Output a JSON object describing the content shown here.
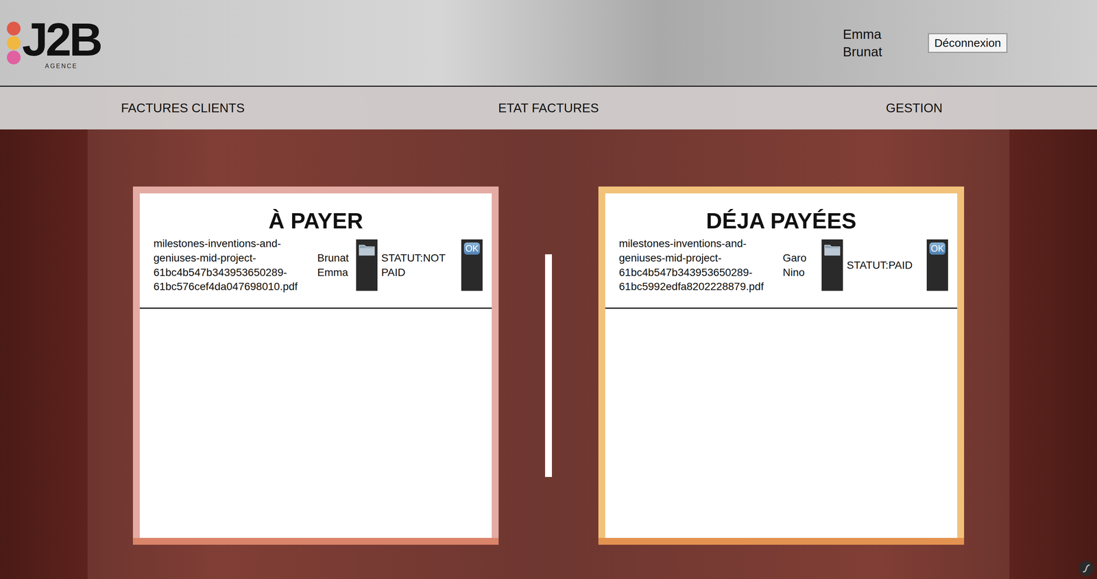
{
  "header": {
    "logo": {
      "text": "J2B",
      "subtitle": "AGENCE"
    },
    "user": {
      "first_name": "Emma",
      "last_name": "Brunat"
    },
    "logout_button": "Déconnexion"
  },
  "nav": [
    {
      "label": "FACTURES CLIENTS"
    },
    {
      "label": "ETAT FACTURES"
    },
    {
      "label": "GESTION"
    }
  ],
  "panels": [
    {
      "title": "À PAYER",
      "color": "#e3aba4",
      "invoices": [
        {
          "file": "milestones-inventions-and-geniuses-mid-project-61bc4b547b343953650289-61bc576cef4da047698010.pdf",
          "client": "Brunat Emma",
          "status": "STATUT:NOT PAID",
          "ok_button": "OK"
        }
      ]
    },
    {
      "title": "DÉJA PAYÉES",
      "color": "#f2c27a",
      "invoices": [
        {
          "file": "milestones-inventions-and-geniuses-mid-project-61bc4b547b343953650289-61bc5992edfa8202228879.pdf",
          "client": "Garo Nino",
          "status": "STATUT:PAID",
          "ok_button": "OK"
        }
      ]
    }
  ]
}
